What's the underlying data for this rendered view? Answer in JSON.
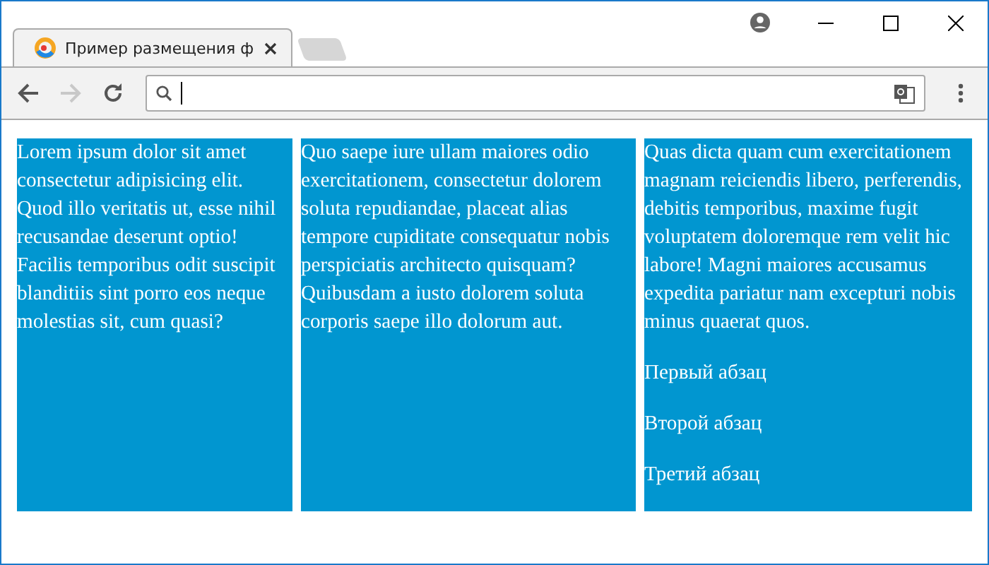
{
  "tab": {
    "title": "Пример размещения ф",
    "selected": true
  },
  "nav": {
    "back_disabled": false,
    "forward_disabled": true
  },
  "columns": [
    {
      "text": "Lorem ipsum dolor sit amet consectetur adipisicing elit. Quod illo veritatis ut, esse nihil recusandae deserunt optio! Facilis temporibus odit suscipit blanditiis sint porro eos neque molestias sit, cum quasi?"
    },
    {
      "text": "Quo saepe iure ullam maiores odio exercitationem, consectetur dolorem soluta repudiandae, placeat alias tempore cupiditate consequatur nobis perspiciatis architecto quisquam? Quibusdam a iusto dolorem soluta corporis saepe illo dolorum aut."
    },
    {
      "text": "Quas dicta quam cum exercitationem magnam reiciendis libero, perferendis, debitis temporibus, maxime fugit voluptatem doloremque rem velit hic labore! Magni maiores accusamus expedita pariatur nam excepturi nobis minus quaerat quos.",
      "paragraphs": [
        "Первый абзац",
        "Второй абзац",
        "Третий абзац"
      ]
    }
  ]
}
